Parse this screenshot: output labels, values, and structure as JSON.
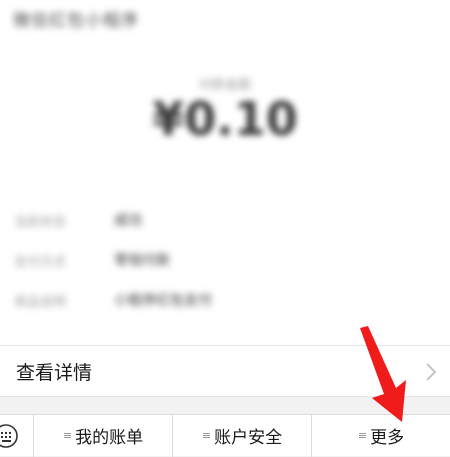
{
  "receipt": {
    "title": "微信红包小程序",
    "amount_label": "付款金额",
    "amount": "¥0.10",
    "rows": [
      {
        "key": "当前状态",
        "value": "成功"
      },
      {
        "key": "支付方式",
        "value": "零钱付款"
      },
      {
        "key": "商品说明",
        "value": "小程序红包支付"
      }
    ]
  },
  "details": {
    "label": "查看详情"
  },
  "menu": {
    "items": [
      {
        "label": "我的账单"
      },
      {
        "label": "账户安全"
      },
      {
        "label": "更多"
      }
    ],
    "menu_glyph": "≡"
  },
  "colors": {
    "arrow": "#f01b1b",
    "background": "#f2f2f2"
  },
  "icons": {
    "keyboard": "keyboard-icon",
    "chevron": "chevron-right-icon",
    "arrow": "pointer-arrow-icon"
  }
}
